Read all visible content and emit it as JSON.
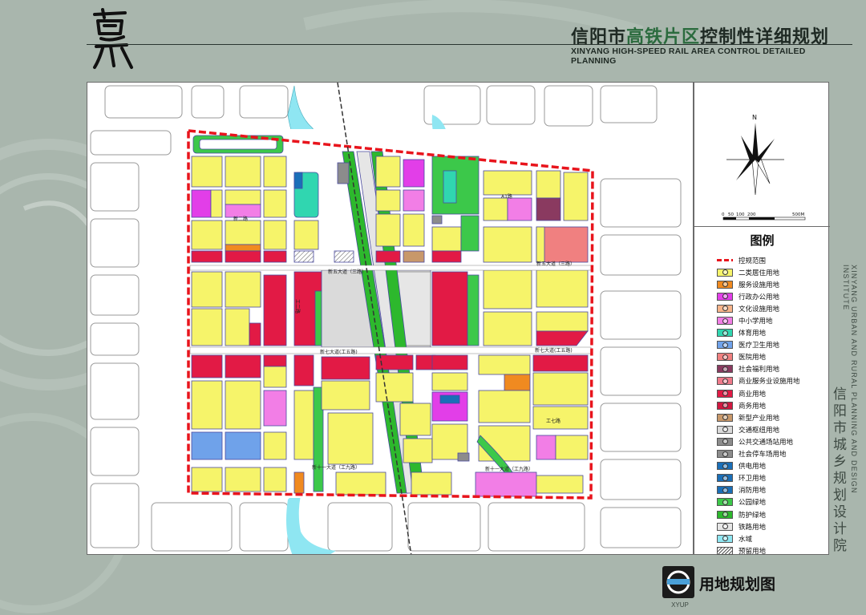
{
  "header": {
    "title_pre": "信阳市",
    "title_hl": "高铁片区",
    "title_post": "控制性详细规划",
    "subtitle": "XINYANG HIGH-SPEED RAIL AREA CONTROL DETAILED PLANNING",
    "logo_text": "高铁"
  },
  "map": {
    "roads": {
      "r1": "新五大道（三路）",
      "r2": "新五大道（三路）",
      "r3": "新七大道(工五路)",
      "r4": "新七大道(工五路)",
      "r5": "新十一大道（工九路）",
      "r6": "新十一大道（工九路）",
      "r7": "工二路",
      "r8": "工七路",
      "r9": "A1路",
      "r10": "新二路"
    },
    "colors": {
      "residential": "#f6f46a",
      "service": "#f08a20",
      "admin": "#e23ee8",
      "school": "#f27ee6",
      "sports": "#30d6b0",
      "medical": "#6fa2ea",
      "hospital": "#f08080",
      "welfare": "#8a3a60",
      "commerce": "#e21a45",
      "business": "#d01840",
      "industry": "#c8986a",
      "transport": "#dadada",
      "bus_station": "#8c8c8c",
      "parking": "#8c8c8c",
      "power": "#1a6fb8",
      "sanitation": "#1a6fb8",
      "fire": "#1a6fb8",
      "park": "#3cc84a",
      "protect_green": "#2db82d",
      "rail": "#e6e6e6",
      "water": "#8fe6f2",
      "boundary": "#e8141c"
    }
  },
  "compass": {
    "north": "N",
    "scale": [
      "0",
      "50",
      "100",
      "200",
      "500M"
    ]
  },
  "legend": {
    "title": "图例",
    "items": [
      {
        "label": "控规范围",
        "color": "",
        "type": "dash"
      },
      {
        "label": "二类居住用地",
        "color": "#f6f46a",
        "type": "fill"
      },
      {
        "label": "服务设施用地",
        "color": "#f08a20",
        "type": "fill"
      },
      {
        "label": "行政办公用地",
        "color": "#e23ee8",
        "type": "fill"
      },
      {
        "label": "文化设施用地",
        "color": "#f8b48a",
        "type": "fill"
      },
      {
        "label": "中小学用地",
        "color": "#f27ee6",
        "type": "fill"
      },
      {
        "label": "体育用地",
        "color": "#30d6b0",
        "type": "fill"
      },
      {
        "label": "医疗卫生用地",
        "color": "#6fa2ea",
        "type": "fill"
      },
      {
        "label": "医院用地",
        "color": "#f08080",
        "type": "fill"
      },
      {
        "label": "社会福利用地",
        "color": "#8a3a60",
        "type": "fill"
      },
      {
        "label": "商业服务业设施用地",
        "color": "#f07a8a",
        "type": "fill"
      },
      {
        "label": "商业用地",
        "color": "#e21a45",
        "type": "fill"
      },
      {
        "label": "商务用地",
        "color": "#d01840",
        "type": "fill"
      },
      {
        "label": "新型产业用地",
        "color": "#c8986a",
        "type": "fill"
      },
      {
        "label": "交通枢纽用地",
        "color": "#dadada",
        "type": "fill"
      },
      {
        "label": "公共交通场站用地",
        "color": "#8c8c8c",
        "type": "fill"
      },
      {
        "label": "社会停车场用地",
        "color": "#8c8c8c",
        "type": "fill"
      },
      {
        "label": "供电用地",
        "color": "#1a6fb8",
        "type": "fill"
      },
      {
        "label": "环卫用地",
        "color": "#1a6fb8",
        "type": "fill"
      },
      {
        "label": "消防用地",
        "color": "#1a6fb8",
        "type": "fill"
      },
      {
        "label": "公园绿地",
        "color": "#3cc84a",
        "type": "fill"
      },
      {
        "label": "防护绿地",
        "color": "#2db82d",
        "type": "fill"
      },
      {
        "label": "铁路用地",
        "color": "#e6e6e6",
        "type": "fill"
      },
      {
        "label": "水域",
        "color": "#8fe6f2",
        "type": "fill"
      },
      {
        "label": "预留用地",
        "color": "",
        "type": "hatch"
      }
    ]
  },
  "side": {
    "vertical_en": "XINYANG URBAN AND RURAL PLANNING AND DESIGN INSTITUTE",
    "vertical_cn": "信阳市城乡规划设计院"
  },
  "footer": {
    "title": "用地规划图",
    "logo_text": "XYUP"
  }
}
